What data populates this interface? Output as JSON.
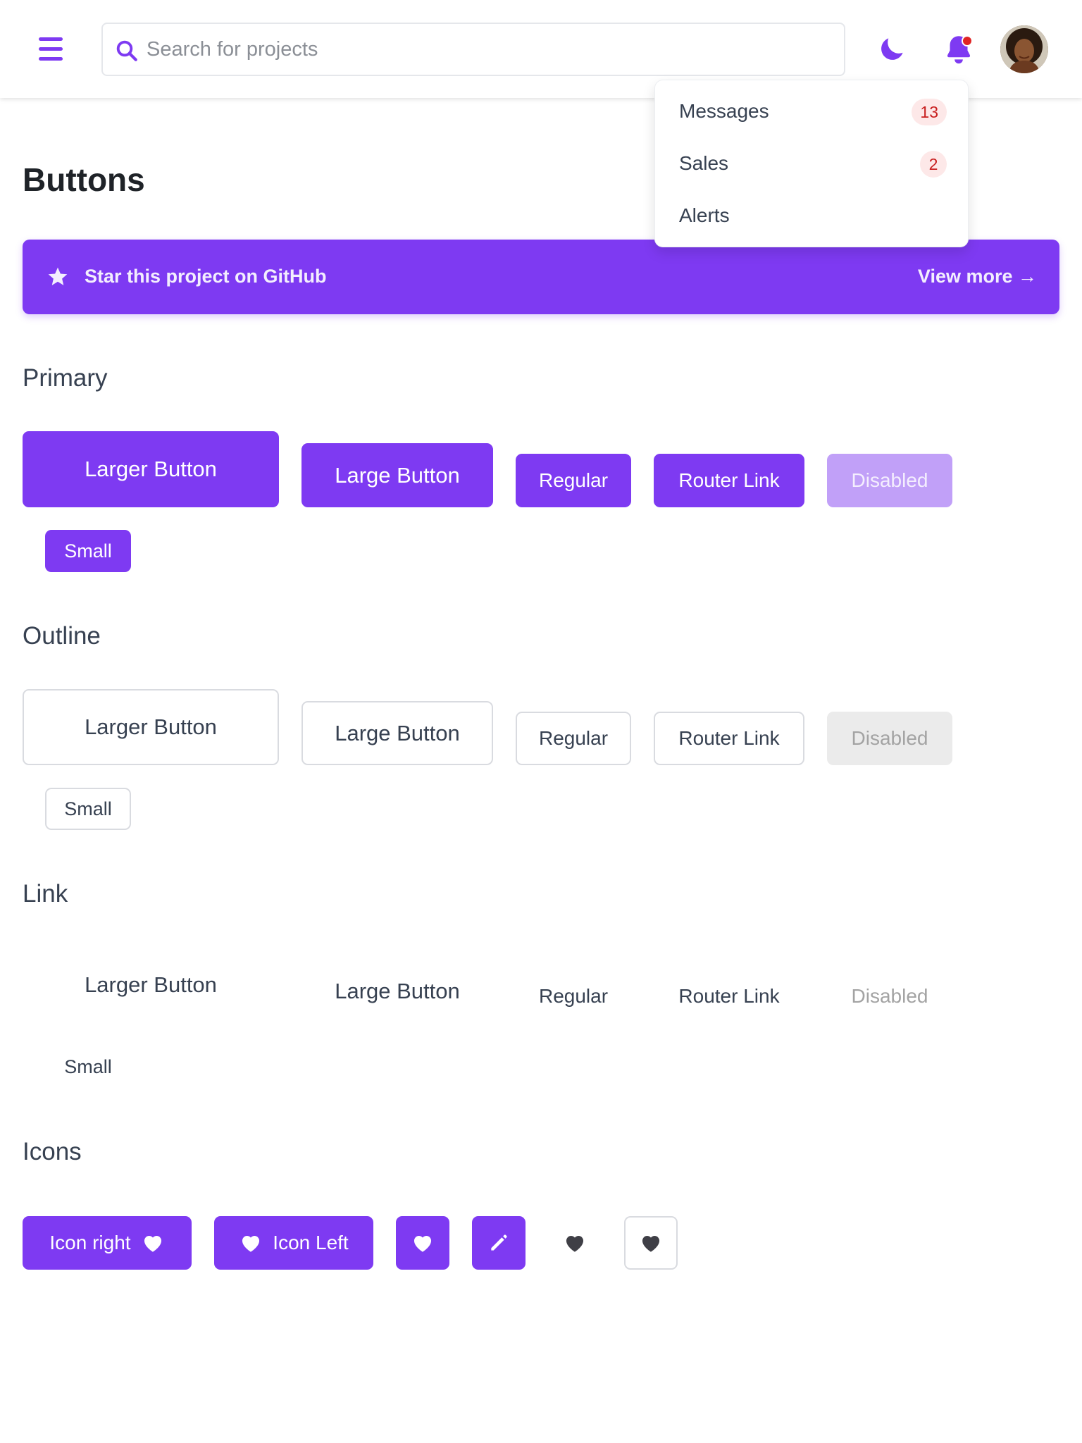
{
  "header": {
    "search": {
      "placeholder": "Search for projects",
      "value": ""
    },
    "notifications_dot_color": "#e02424",
    "icons": [
      "menu-icon",
      "search-icon",
      "moon-icon",
      "bell-icon",
      "avatar"
    ]
  },
  "dropdown": {
    "items": [
      {
        "label": "Messages",
        "badge": "13"
      },
      {
        "label": "Sales",
        "badge": "2"
      },
      {
        "label": "Alerts",
        "badge": ""
      }
    ]
  },
  "page": {
    "title": "Buttons",
    "banner": {
      "text": "Star this project on GitHub",
      "link": "View more →"
    }
  },
  "sections": {
    "primary": {
      "title": "Primary",
      "buttons": {
        "larger": "Larger Button",
        "large": "Large Button",
        "regular": "Regular",
        "router": "Router Link",
        "disabled": "Disabled",
        "small": "Small"
      }
    },
    "outline": {
      "title": "Outline",
      "buttons": {
        "larger": "Larger Button",
        "large": "Large Button",
        "regular": "Regular",
        "router": "Router Link",
        "disabled": "Disabled",
        "small": "Small"
      }
    },
    "link": {
      "title": "Link",
      "buttons": {
        "larger": "Larger Button",
        "large": "Large Button",
        "regular": "Regular",
        "router": "Router Link",
        "disabled": "Disabled",
        "small": "Small"
      }
    },
    "icons": {
      "title": "Icons",
      "buttons": {
        "icon_right": "Icon right",
        "icon_left": "Icon Left"
      }
    }
  },
  "colors": {
    "accent": "#7e3af2",
    "accent_disabled": "#c1a0f8",
    "badge_bg": "#fde8e8",
    "badge_text": "#c81e1e"
  }
}
